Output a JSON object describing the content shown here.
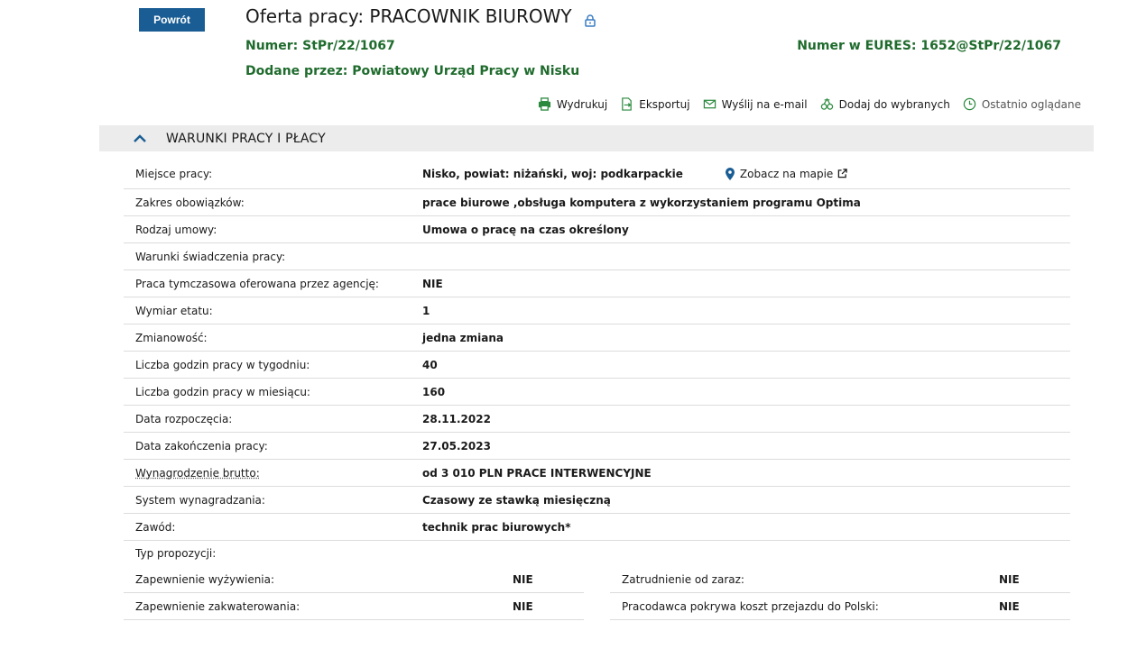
{
  "header": {
    "back_label": "Powrót",
    "title": "Oferta pracy: PRACOWNIK BIUROWY",
    "number_label": "Numer:",
    "number_value": "StPr/22/1067",
    "eures_label": "Numer w EURES:",
    "eures_value": "1652@StPr/22/1067",
    "added_label": "Dodane przez:",
    "added_value": "Powiatowy Urząd Pracy w Nisku"
  },
  "actions": {
    "print": "Wydrukuj",
    "export": "Eksportuj",
    "email": "Wyślij na e-mail",
    "favorite": "Dodaj do wybranych",
    "recent": "Ostatnio oglądane"
  },
  "section": {
    "title": "WARUNKI PRACY I PŁACY",
    "map_link": "Zobacz na mapie",
    "rows": [
      {
        "k": "Miejsce pracy:",
        "v": "Nisko, powiat: niżański, woj: podkarpackie"
      },
      {
        "k": "Zakres obowiązków:",
        "v": "prace biurowe ,obsługa komputera z wykorzystaniem programu Optima"
      },
      {
        "k": "Rodzaj umowy:",
        "v": "Umowa o pracę na czas określony"
      },
      {
        "k": "Warunki świadczenia pracy:",
        "v": ""
      },
      {
        "k": "Praca tymczasowa oferowana przez agencję:",
        "v": "NIE"
      },
      {
        "k": "Wymiar etatu:",
        "v": "1"
      },
      {
        "k": "Zmianowość:",
        "v": "jedna zmiana"
      },
      {
        "k": "Liczba godzin pracy w tygodniu:",
        "v": "40"
      },
      {
        "k": "Liczba godzin pracy w miesiącu:",
        "v": "160"
      },
      {
        "k": "Data rozpoczęcia:",
        "v": "28.11.2022"
      },
      {
        "k": "Data zakończenia pracy:",
        "v": "27.05.2023"
      },
      {
        "k": "Wynagrodzenie brutto:",
        "v": "od 3 010 PLN PRACE INTERWENCYJNE"
      },
      {
        "k": "System wynagradzania:",
        "v": "Czasowy ze stawką miesięczną"
      },
      {
        "k": "Zawód:",
        "v": "technik prac biurowych*"
      }
    ],
    "proposal_type_label": "Typ propozycji:",
    "left": [
      {
        "k": "Zapewnienie wyżywienia:",
        "v": "NIE"
      },
      {
        "k": "Zapewnienie zakwaterowania:",
        "v": "NIE"
      }
    ],
    "right": [
      {
        "k": "Zatrudnienie od zaraz:",
        "v": "NIE"
      },
      {
        "k": "Pracodawca pokrywa koszt przejazdu do Polski:",
        "v": "NIE"
      }
    ]
  },
  "colors": {
    "accent": "#195d94",
    "green": "#1f6b2d",
    "section_bg": "#ececec"
  }
}
